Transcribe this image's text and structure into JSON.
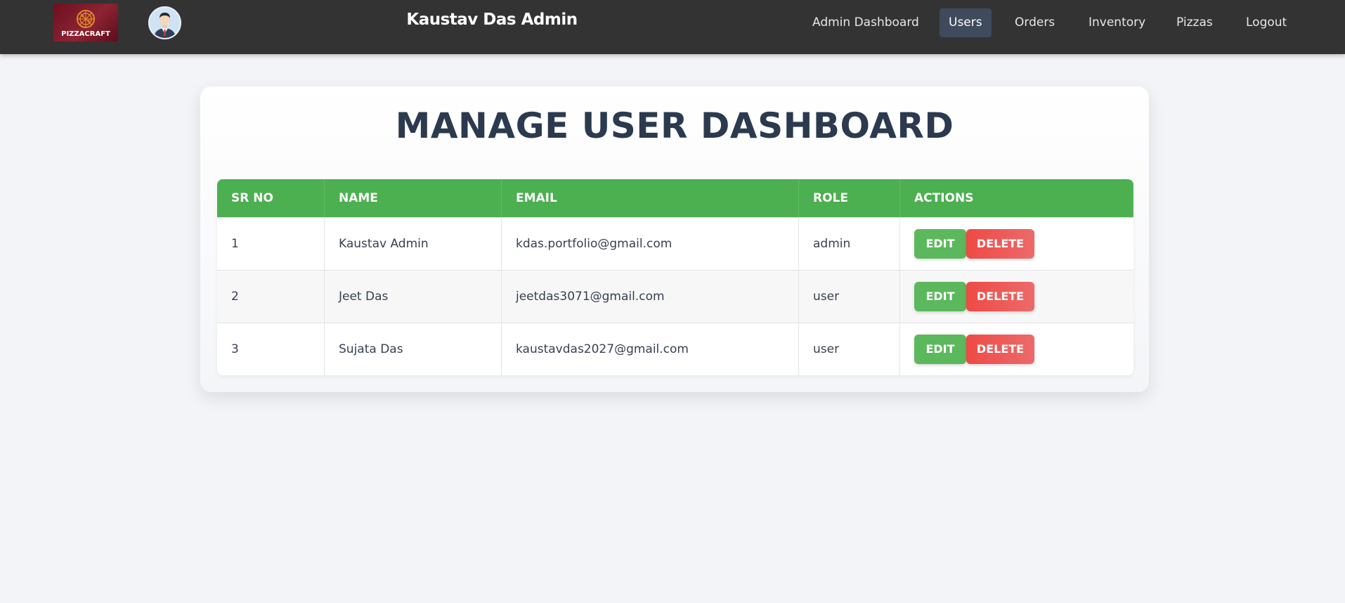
{
  "header": {
    "logo_text": "PIZZACRAFT",
    "title": "Kaustav Das Admin",
    "nav": [
      {
        "label": "Admin Dashboard",
        "active": false
      },
      {
        "label": "Users",
        "active": true
      },
      {
        "label": "Orders",
        "active": false
      },
      {
        "label": "Inventory",
        "active": false
      },
      {
        "label": "Pizzas",
        "active": false
      },
      {
        "label": "Logout",
        "active": false
      }
    ]
  },
  "main": {
    "title": "MANAGE USER DASHBOARD",
    "table": {
      "columns": [
        "SR NO",
        "NAME",
        "EMAIL",
        "ROLE",
        "ACTIONS"
      ],
      "rows": [
        {
          "sr": "1",
          "name": "Kaustav Admin",
          "email": "kdas.portfolio@gmail.com",
          "role": "admin"
        },
        {
          "sr": "2",
          "name": "Jeet Das",
          "email": "jeetdas3071@gmail.com",
          "role": "user"
        },
        {
          "sr": "3",
          "name": "Sujata Das",
          "email": "kaustavdas2027@gmail.com",
          "role": "user"
        }
      ],
      "edit_label": "EDIT",
      "delete_label": "DELETE"
    }
  },
  "colors": {
    "navbar": "#333333",
    "header_row": "#4caf50",
    "edit": "#5cb85c",
    "delete": "#ee4a46",
    "title": "#2b3a4e",
    "active_nav": "#3f4a5c"
  },
  "icons": {
    "logo": "pizza-icon",
    "avatar": "user-avatar-icon"
  }
}
